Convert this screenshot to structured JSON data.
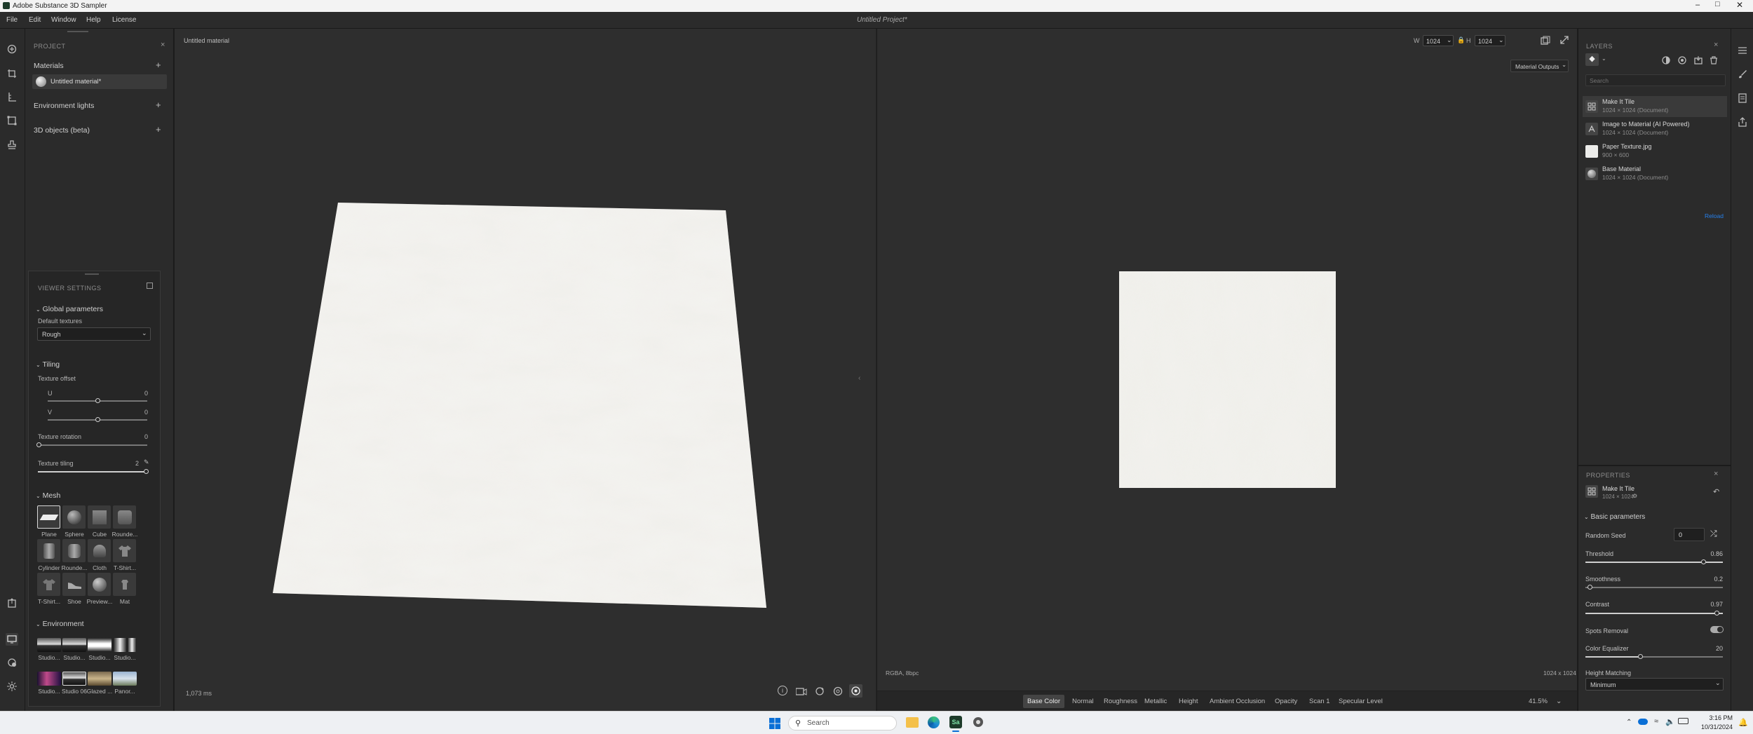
{
  "app": {
    "title": "Adobe Substance 3D Sampler",
    "document_title": "Untitled Project*"
  },
  "menu": [
    "File",
    "Edit",
    "Window",
    "Help",
    "License"
  ],
  "project": {
    "header": "PROJECT",
    "materials_label": "Materials",
    "material_item": "Untitled material*",
    "env_lights_label": "Environment lights",
    "objects_label": "3D objects (beta)"
  },
  "viewer_settings": {
    "header": "VIEWER SETTINGS",
    "global_params": "Global parameters",
    "default_textures_label": "Default textures",
    "default_textures_value": "Rough",
    "tiling": "Tiling",
    "texture_offset": "Texture offset",
    "u_label": "U",
    "u_value": "0",
    "v_label": "V",
    "v_value": "0",
    "rotation_label": "Texture rotation",
    "rotation_value": "0",
    "tiling_label": "Texture tiling",
    "tiling_value": "2",
    "mesh": "Mesh",
    "meshes": [
      "Plane",
      "Sphere",
      "Cube",
      "Rounde...",
      "Cylinder",
      "Rounde...",
      "Cloth",
      "T-Shirt...",
      "T-Shirt...",
      "Shoe",
      "Preview...",
      "Mat"
    ],
    "environment": "Environment",
    "environments": [
      "Studio...",
      "Studio...",
      "Studio...",
      "Studio...",
      "Studio...",
      "Studio 06",
      "Glazed ...",
      "Panor..."
    ]
  },
  "viewport3d": {
    "title": "Untitled material",
    "render_time": "1,073 ms"
  },
  "viewport2d": {
    "width": "1024",
    "height": "1024",
    "outputs_label": "Material Outputs",
    "format": "RGBA, 8bpc",
    "dims": "1024 x 1024",
    "zoom": "41.5%",
    "channels": [
      "Base Color",
      "Normal",
      "Roughness",
      "Metallic",
      "Height",
      "Ambient Occlusion",
      "Opacity",
      "Scan 1",
      "Specular Level"
    ]
  },
  "layers": {
    "header": "LAYERS",
    "search_placeholder": "Search",
    "items": [
      {
        "name": "Make It Tile",
        "sub": "1024 × 1024 (Document)"
      },
      {
        "name": "Image to Material (AI Powered)",
        "sub": "1024 × 1024 (Document)"
      },
      {
        "name": "Paper Texture.jpg",
        "sub": "900 × 600"
      },
      {
        "name": "Base Material",
        "sub": "1024 × 1024 (Document)"
      }
    ],
    "reload": "Reload"
  },
  "properties": {
    "header": "PROPERTIES",
    "filter_name": "Make It Tile",
    "filter_size": "1024 × 1024",
    "basic_params": "Basic parameters",
    "random_seed_label": "Random Seed",
    "random_seed_value": "0",
    "threshold_label": "Threshold",
    "threshold_value": "0.86",
    "smoothness_label": "Smoothness",
    "smoothness_value": "0.2",
    "contrast_label": "Contrast",
    "contrast_value": "0.97",
    "spots_label": "Spots Removal",
    "color_eq_label": "Color Equalizer",
    "color_eq_value": "20",
    "height_match_label": "Height Matching",
    "height_match_value": "Minimum"
  },
  "taskbar": {
    "search": "Search",
    "time": "3:16 PM",
    "date": "10/31/2024"
  },
  "colors": {
    "accent": "#2680eb",
    "panel": "#2b2b2b",
    "viewport": "#2e2e2e"
  }
}
